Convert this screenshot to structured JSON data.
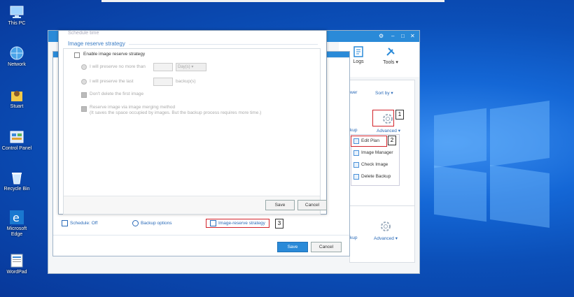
{
  "desktop": {
    "icons": [
      {
        "label": "This PC",
        "icon": "computer-icon"
      },
      {
        "label": "Network",
        "icon": "network-icon"
      },
      {
        "label": "Stuart",
        "icon": "user-folder-icon"
      },
      {
        "label": "Control Panel",
        "icon": "control-panel-icon"
      },
      {
        "label": "Recycle Bin",
        "icon": "recycle-bin-icon"
      },
      {
        "label": "Microsoft Edge",
        "icon": "edge-icon"
      },
      {
        "label": "WordPad",
        "icon": "wordpad-icon"
      }
    ]
  },
  "app": {
    "toolbar": {
      "logs_label": "Logs",
      "tools_label": "Tools"
    },
    "right_panel": {
      "viewer_label": "wer",
      "sort_label": "Sort by",
      "backup_label": "kup",
      "advanced_label": "Advanced",
      "backup2_label": "kup",
      "advanced2_label": "Advanced"
    },
    "menu_items": [
      "Edit Plan",
      "Image Manager",
      "Check Image",
      "Delete Backup"
    ],
    "callouts": [
      "1",
      "2",
      "3"
    ],
    "accent": "#2a8ad8",
    "callout_color": "#d2232a"
  },
  "options_dialog": {
    "schedule_label": "Schedule: Off",
    "backup_options_label": "Backup options",
    "image_reserve_label": "Image-reserve strategy",
    "save_label": "Save",
    "cancel_label": "Cancel"
  },
  "reserve_dialog": {
    "faded_header": "Schedule time",
    "section_title": "Image reserve strategy",
    "enable_label": "Enable image reserve strategy",
    "option1_prefix": "I will preserve no more than",
    "option1_unit": "Day(s)",
    "option2_prefix": "I will preserve the last",
    "option2_unit": "backup(s)",
    "dont_delete_label": "Don't delete the first image",
    "merge_label": "Reserve image via image merging method",
    "merge_note": "(It saves the space occupied by images. But the backup process requires more time.)",
    "save_label": "Save",
    "cancel_label": "Cancel"
  }
}
